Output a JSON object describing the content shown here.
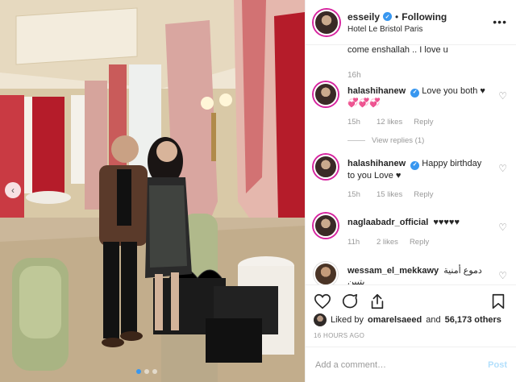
{
  "post": {
    "author": "esseily",
    "follow_separator": "•",
    "follow_state": "Following",
    "location": "Hotel Le Bristol Paris",
    "more_icon": "more-horizontal-icon",
    "verified": true
  },
  "comments": {
    "partial_text": "come enshallah .. I love u",
    "partial_time": "16h",
    "items": [
      {
        "username": "halashihanew",
        "text": "Love you both ♥ 💞💞💞",
        "time": "15h",
        "likes": "12 likes",
        "reply": "Reply",
        "view_replies": "View replies (1)"
      },
      {
        "username": "halashihanew",
        "text": "Happy birthday to you Love ♥",
        "time": "15h",
        "likes": "15 likes",
        "reply": "Reply"
      },
      {
        "username": "naglaabadr_official",
        "text": "♥♥♥♥♥",
        "time": "11h",
        "likes": "2 likes",
        "reply": "Reply"
      },
      {
        "username": "wessam_el_mekkawy",
        "text": "دموع أمنية بتبين"
      }
    ]
  },
  "actions": {
    "like_icon": "heart-icon",
    "comment_icon": "comment-icon",
    "share_icon": "share-icon",
    "save_icon": "bookmark-icon"
  },
  "likes": {
    "prefix": "Liked by",
    "user": "omarelsaeed",
    "and": "and",
    "count": "56,173 others"
  },
  "timestamp": "16 HOURS AGO",
  "add_comment": {
    "placeholder": "Add a comment…",
    "post_label": "Post"
  },
  "colors": {
    "accent": "#3897f0",
    "muted": "#999999",
    "post_disabled": "#b2dffc",
    "curtain_red": "#b51c2a"
  }
}
